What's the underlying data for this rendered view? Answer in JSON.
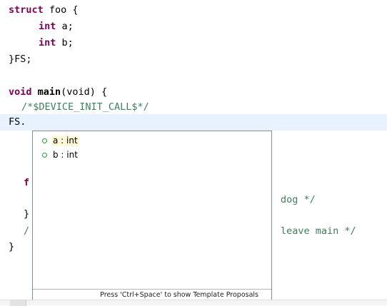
{
  "editor": {
    "lines": {
      "l1": {
        "kw": "struct",
        "rest": " foo {"
      },
      "l2": {
        "kw": "int",
        "rest": " a;"
      },
      "l3": {
        "kw": "int",
        "rest": " b;"
      },
      "l4": {
        "text": "}FS;"
      },
      "l6": {
        "kw": "void",
        "name": " main",
        "rest": "(void) {"
      },
      "l7": {
        "comment": "/*$DEVICE_INIT_CALL$*/"
      },
      "l8": {
        "text": "FS."
      },
      "l11": {
        "text": "f"
      },
      "l12": {
        "comment": "dog */"
      },
      "l13": {
        "text": "}"
      },
      "l14": {
        "text": "/",
        "comment": "leave main */"
      },
      "l15": {
        "text": "}"
      }
    }
  },
  "content_assist": {
    "proposals": [
      {
        "label": "a : int",
        "selected": true,
        "icon": "field-icon"
      },
      {
        "label": "b : int",
        "selected": false,
        "icon": "field-icon"
      }
    ],
    "footer_hint": "Press 'Ctrl+Space' to show Template Proposals"
  },
  "colors": {
    "keyword": "#7f0055",
    "comment": "#3f7f5f",
    "current_line": "#e8f2fe",
    "field_icon": "#2e9a3a"
  }
}
